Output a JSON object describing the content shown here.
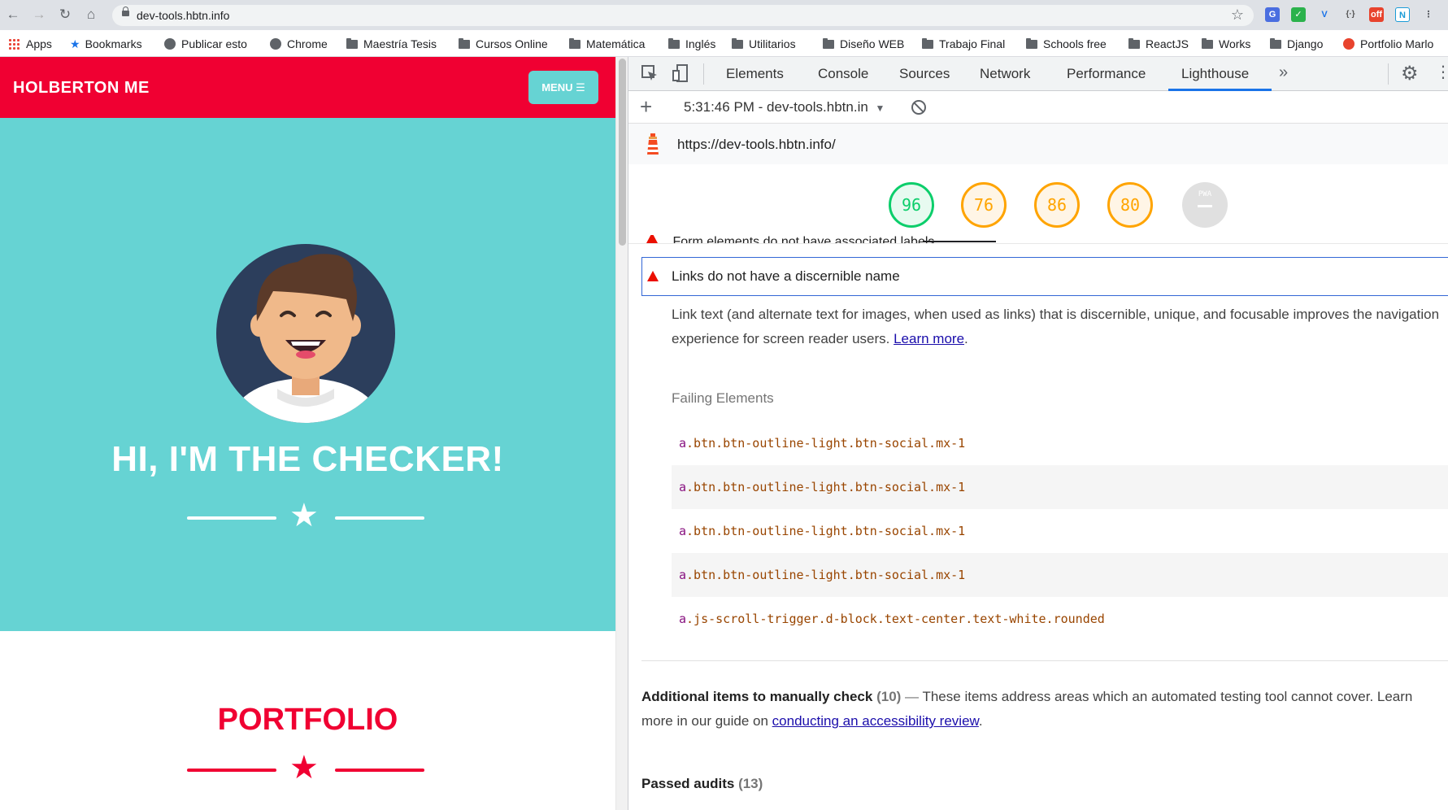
{
  "browser": {
    "url": "dev-tools.hbtn.info",
    "bookmarks": [
      "Apps",
      "Bookmarks",
      "Publicar esto",
      "Chrome",
      "Maestría Tesis",
      "Cursos Online",
      "Matemática",
      "Inglés",
      "Utilitarios",
      "Diseño WEB",
      "Trabajo Final",
      "Schools free",
      "ReactJS",
      "Works",
      "Django",
      "Portfolio Marlo"
    ]
  },
  "site": {
    "brand": "HOLBERTON ME",
    "menu_label": "MENU ☰",
    "hero_title": "HI, I'M THE CHECKER!",
    "portfolio_heading": "PORTFOLIO"
  },
  "devtools": {
    "tabs": [
      "Elements",
      "Console",
      "Sources",
      "Network",
      "Performance",
      "Lighthouse"
    ],
    "active_tab": "Lighthouse",
    "report_select": "5:31:46 PM - dev-tools.hbtn.in",
    "report_url": "https://dev-tools.hbtn.info/",
    "scores": [
      {
        "value": "96",
        "color": "#0cce6b"
      },
      {
        "value": "76",
        "color": "#ffa400"
      },
      {
        "value": "86",
        "color": "#ffa400"
      },
      {
        "value": "80",
        "color": "#ffa400"
      }
    ],
    "pwa_label": "PWA",
    "cut_off_audit": "Form elements do not have associated labels",
    "audit": {
      "title": "Links do not have a discernible name",
      "description": "Link text (and alternate text for images, when used as links) that is discernible, unique, and focusable improves the navigation experience for screen reader users.",
      "learn_more": "Learn more",
      "failing_label": "Failing Elements",
      "failing": [
        {
          "tag": "a",
          "classes": ".btn.btn-outline-light.btn-social.mx-1"
        },
        {
          "tag": "a",
          "classes": ".btn.btn-outline-light.btn-social.mx-1"
        },
        {
          "tag": "a",
          "classes": ".btn.btn-outline-light.btn-social.mx-1"
        },
        {
          "tag": "a",
          "classes": ".btn.btn-outline-light.btn-social.mx-1"
        },
        {
          "tag": "a",
          "classes": ".js-scroll-trigger.d-block.text-center.text-white.rounded"
        }
      ]
    },
    "additional": {
      "title": "Additional items to manually check",
      "count": "(10)",
      "dash": "—",
      "text": "These items address areas which an automated testing tool cannot cover. Learn more in our guide on",
      "link": "conducting an accessibility review"
    },
    "passed": {
      "title": "Passed audits",
      "count": "(13)"
    }
  }
}
